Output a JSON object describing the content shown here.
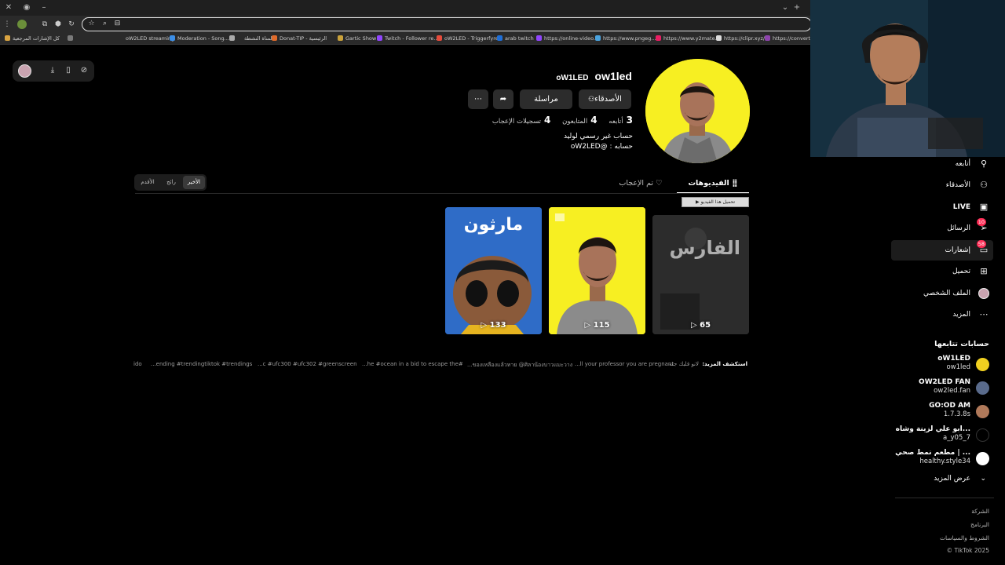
{
  "browser": {
    "bookmarks": [
      {
        "label": "كل الإشارات المرجعية",
        "color": "#d9a441"
      },
      {
        "label": "",
        "color": "#7a7a7a"
      },
      {
        "label": "oW2LED streaming",
        "color": "#8e44ad"
      },
      {
        "label": "Moderation - Song...",
        "color": "#3c8ee6"
      },
      {
        "label": "",
        "color": "#aaa"
      },
      {
        "label": "المناة النشطة",
        "color": "#444"
      },
      {
        "label": "Donat-TIP - الرئيسية",
        "color": "#e06b2b"
      },
      {
        "label": "Gartic Show",
        "color": "#caa23b"
      },
      {
        "label": "Twitch - Follower re...",
        "color": "#9146ff"
      },
      {
        "label": "oW2LED - Triggerfyre",
        "color": "#e74c3c"
      },
      {
        "label": "arab twitch",
        "color": "#1f6fd8"
      },
      {
        "label": "https://online-video...",
        "color": "#9146ff"
      },
      {
        "label": "https://www.pngeg...",
        "color": "#4aa3df"
      },
      {
        "label": "https://www.y2mate...",
        "color": "#e91e63"
      },
      {
        "label": "https://clipr.xyz/",
        "color": "#ddd"
      },
      {
        "label": "https://convert-...",
        "color": "#8e44ad"
      }
    ]
  },
  "profile": {
    "unique_id": "ow1led",
    "nickname": "oW1LED",
    "friends_button": "الأصدقاء",
    "message_button": "مراسلة",
    "share_icon": "share-icon",
    "more_icon": "ellipsis-icon",
    "stats": {
      "following_count": "3",
      "following_label": "أتابعه",
      "followers_count": "4",
      "followers_label": "المتابعون",
      "likes_count": "4",
      "likes_label": "تسجيلات الإعجاب"
    },
    "bio_line1": "حساب غير رسمي لوليد",
    "bio_line2": "حسابه : @oW2LED"
  },
  "tabs": {
    "videos": "الفيديوهات",
    "liked": "تم الإعجاب"
  },
  "sort": {
    "latest": "الأخير",
    "popular": "رائج",
    "oldest": "الأقدم"
  },
  "download_badge": "تحميل هذا الفيديو",
  "videos": [
    {
      "views": "65",
      "overlay_text": "الفارس"
    },
    {
      "views": "115"
    },
    {
      "views": "133",
      "overlay_text": "مارثون"
    }
  ],
  "explore": {
    "label": "استكشف المزيد:",
    "items": [
      "لانو قلبك جنه",
      "...ll your professor you are pregnant",
      "...ของเหลืองแล้วทาย @ศิลาน้องบาวแมะวาง",
      "...he #ocean in a bid to escape the#",
      "...c #ufc300 #ufc302 #greenscreen",
      "...ending #trendingtiktok #trendings",
      "ido"
    ]
  },
  "sidebar": {
    "following": "أتابعه",
    "friends": "الأصدقاء",
    "live": "LIVE",
    "messages": "الرسائل",
    "messages_badge": "10",
    "inbox": "الإشعارات",
    "inbox_label_visible": "إشعارات",
    "inbox_badge": "58",
    "upload": "تحميل",
    "profile": "الملف الشخصي",
    "more": "المزيد",
    "following_accounts_title": "حسابات تتابعها",
    "accounts": [
      {
        "name": "oW1LED",
        "id": "ow1led",
        "avatar_color": "#f0d020"
      },
      {
        "name": "OW2LED FAN",
        "id": "ow2led.fan",
        "avatar_color": "#5a6b8c"
      },
      {
        "name": "GO:OD AM",
        "id": "1.7.3.8s",
        "avatar_color": "#b0795a"
      },
      {
        "name": "ابو علي لزينة وشاه...",
        "id": "a_y05_7",
        "avatar_color": "#000000"
      },
      {
        "name": "مطعم نمط صحي | ...",
        "id": "healthy.style34",
        "avatar_color": "#ffffff"
      }
    ],
    "see_more": "عرض المزيد",
    "footer": [
      "الشركة",
      "البرنامج",
      "الشروط والسياسات",
      "© TikTok 2025"
    ]
  }
}
